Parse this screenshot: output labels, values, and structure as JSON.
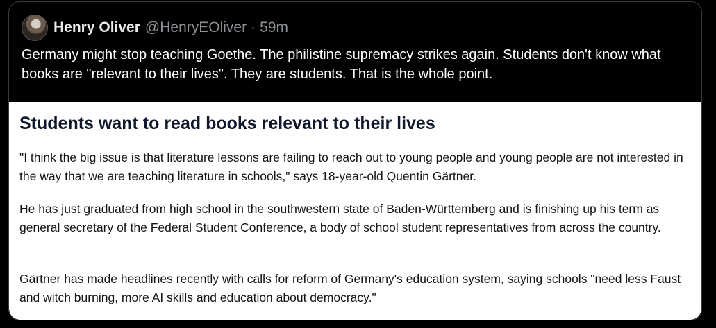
{
  "tweet": {
    "author_name": "Henry Oliver",
    "handle": "@HenryEOliver",
    "separator": "·",
    "time": "59m",
    "text": "Germany might stop teaching Goethe. The philistine supremacy strikes again. Students don't know what books are \"relevant to their lives\". They are students. That is the whole point."
  },
  "card": {
    "title": "Students want to read books relevant to their lives",
    "paragraphs": [
      "\"I think the big issue is that literature lessons are failing to reach out to young people and young people are not interested in the way that we are teaching literature in schools,\" says 18-year-old Quentin Gärtner.",
      "He has just graduated from high school in the southwestern state of Baden-Württemberg and is finishing up his term as general secretary of the Federal Student Conference, a body of school student representatives from across the country.",
      "Gärtner has made headlines recently with calls for reform of Germany's education system, saying schools \"need less Faust and witch burning, more AI skills and education about democracy.\""
    ]
  },
  "icons": {
    "avatar": "avatar-photo"
  }
}
